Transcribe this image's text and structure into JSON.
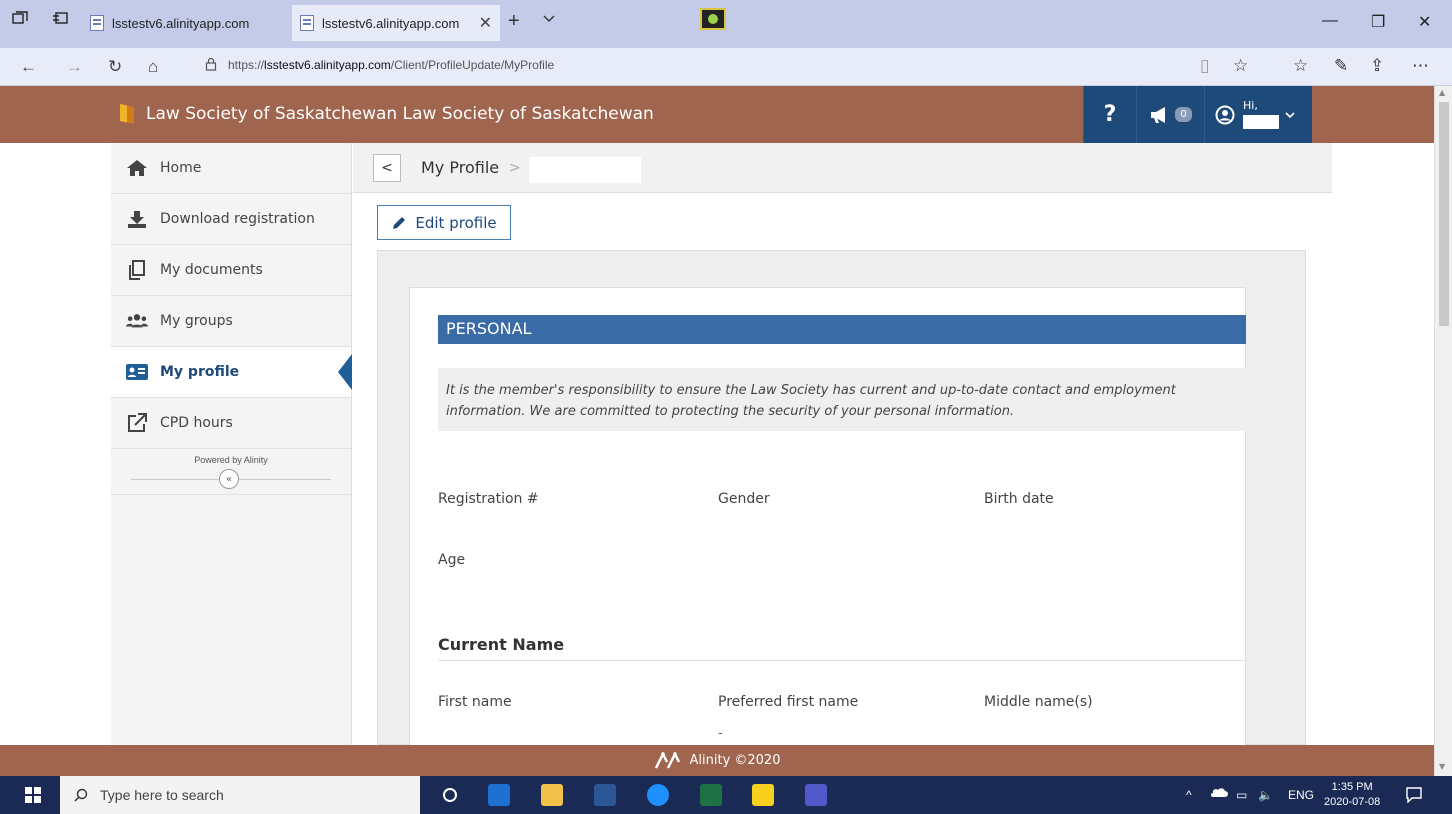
{
  "browser": {
    "tabs": [
      {
        "title": "lsstestv6.alinityapp.com",
        "active": false
      },
      {
        "title": "lsstestv6.alinityapp.com",
        "active": true
      }
    ],
    "new_tab": "+",
    "url_prefix": "https://",
    "url_host": "lsstestv6.alinityapp.com",
    "url_path": "/Client/ProfileUpdate/MyProfile"
  },
  "header": {
    "brand": "Law Society of Saskatchewan Law Society of Saskatchewan",
    "help_label": "?",
    "notification_count": "0",
    "greeting": "Hi,"
  },
  "sidebar": {
    "items": [
      {
        "label": "Home",
        "icon": "home-icon"
      },
      {
        "label": "Download registration",
        "icon": "download-icon"
      },
      {
        "label": "My documents",
        "icon": "documents-icon"
      },
      {
        "label": "My groups",
        "icon": "groups-icon"
      },
      {
        "label": "My profile",
        "icon": "profile-card-icon",
        "active": true
      },
      {
        "label": "CPD hours",
        "icon": "external-link-icon"
      }
    ],
    "powered_by": "Powered by Alinity",
    "collapse_label": "«"
  },
  "breadcrumb": {
    "back": "<",
    "current": "My Profile",
    "separator": ">"
  },
  "edit_button": "Edit profile",
  "profile": {
    "section_title": "PERSONAL",
    "notice": "It is the member's responsibility to ensure the Law Society has current and up-to-date contact and employment information. We are committed to protecting the security of your personal information.",
    "fields_row1": [
      "Registration #",
      "Gender",
      "Birth date"
    ],
    "fields_row2": [
      "Age"
    ],
    "current_name_heading": "Current Name",
    "fields_row3": [
      "First name",
      "Preferred first name",
      "Middle name(s)"
    ],
    "preferred_first_name_value": "-"
  },
  "footer": {
    "text": "Alinity ©2020"
  },
  "taskbar": {
    "search_placeholder": "Type here to search",
    "language": "ENG",
    "time": "1:35 PM",
    "date": "2020-07-08"
  },
  "colors": {
    "brand_brown": "#a0654e",
    "header_blue": "#1e4a7a",
    "section_blue": "#3a6ba6",
    "taskbar": "#1a2a55"
  }
}
